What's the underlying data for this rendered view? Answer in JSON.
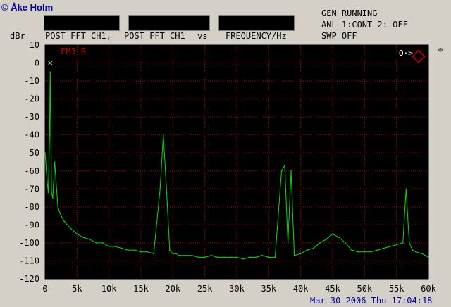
{
  "credit": "© Åke Holm",
  "header": {
    "part1": "POST FFT CH1,",
    "part2": "POST FFT CH1",
    "part3": "vs",
    "part4": "FREQUENCY/Hz"
  },
  "status": {
    "line1": "GEN RUNNING",
    "line2": "ANL 1:CONT 2: OFF",
    "line3": "SWP OFF"
  },
  "side_button": "⊖",
  "marker_text": "O·>",
  "footer": "Mar 30 2006 Thu 17:04:18",
  "colors": {
    "plot_bg": "#000000",
    "grid": "#c00000",
    "trace": "#00e000",
    "highlight": "#ffff00"
  },
  "chart_data": {
    "type": "line",
    "title": "",
    "annotation": "FM3 R",
    "xlabel": "FREQUENCY/Hz",
    "ylabel": "dBr",
    "xlim": [
      0,
      60000
    ],
    "ylim": [
      -120,
      10
    ],
    "grid": true,
    "x_ticks": [
      "0",
      "5k",
      "10k",
      "15k",
      "20k",
      "25k",
      "30k",
      "35k",
      "40k",
      "45k",
      "50k",
      "55k",
      "60k"
    ],
    "y_ticks": [
      "10",
      "0",
      "-10",
      "-20",
      "-30",
      "-40",
      "-50",
      "-60",
      "-70",
      "-80",
      "-90",
      "-100",
      "-110",
      "-120"
    ],
    "series": [
      {
        "x": [
          0,
          300,
          500,
          700,
          800,
          900,
          1000,
          1200,
          1500,
          2000,
          2500,
          3000,
          3500,
          4000,
          5000,
          6000,
          7000,
          8000,
          9000,
          10000,
          11000,
          12000,
          13000,
          14000,
          15000,
          16000,
          17000,
          18000,
          18500,
          19000,
          19500,
          20000,
          20500,
          21000,
          22000,
          23000,
          24000,
          25000,
          26000,
          27000,
          28000,
          29000,
          30000,
          31000,
          32000,
          33000,
          34000,
          35000,
          36000,
          37000,
          37500,
          38000,
          38500,
          39000,
          40000,
          41000,
          42000,
          43000,
          44000,
          45000,
          46000,
          47000,
          48000,
          49000,
          50000,
          51000,
          52000,
          53000,
          54000,
          55000,
          56000,
          56500,
          57000,
          57500,
          58000,
          59000,
          60000
        ],
        "y": [
          -50,
          -65,
          -72,
          -40,
          -5,
          -40,
          -72,
          -75,
          -55,
          -80,
          -85,
          -88,
          -90,
          -92,
          -95,
          -97,
          -98,
          -100,
          -100,
          -102,
          -102,
          -103,
          -104,
          -104,
          -105,
          -105,
          -106,
          -70,
          -40,
          -70,
          -104,
          -106,
          -106,
          -107,
          -107,
          -107,
          -108,
          -108,
          -107,
          -108,
          -108,
          -108,
          -108,
          -109,
          -108,
          -108,
          -107,
          -108,
          -108,
          -60,
          -57,
          -100,
          -60,
          -107,
          -106,
          -104,
          -103,
          -100,
          -98,
          -95,
          -97,
          -100,
          -104,
          -105,
          -105,
          -105,
          -104,
          -103,
          -102,
          -101,
          -100,
          -70,
          -100,
          -104,
          -105,
          -106,
          -108
        ]
      }
    ]
  }
}
